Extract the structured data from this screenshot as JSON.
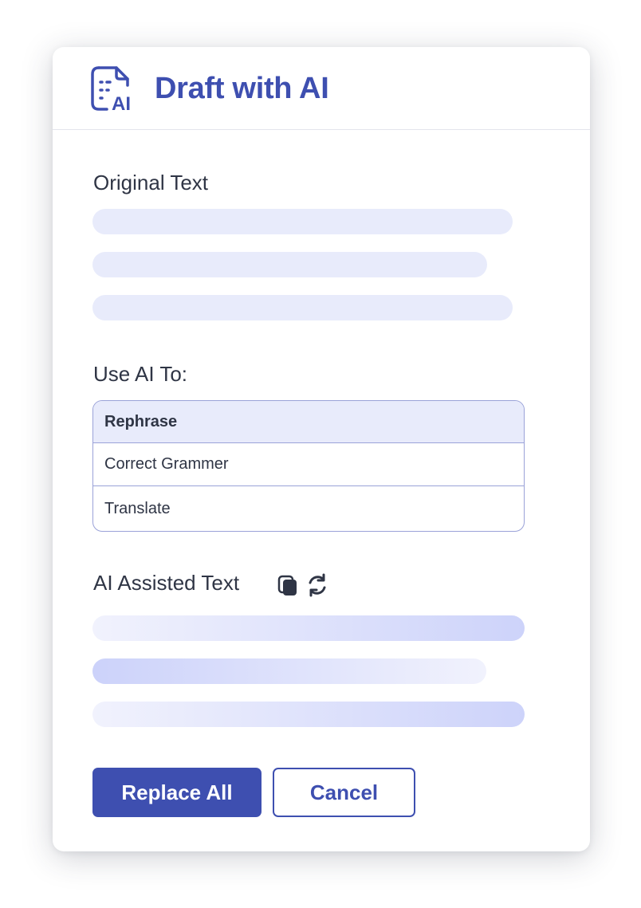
{
  "header": {
    "title": "Draft with AI",
    "icon": "document-ai-icon",
    "icon_label": "AI"
  },
  "original": {
    "label": "Original Text",
    "placeholder_lines": 3
  },
  "use_ai": {
    "label": "Use AI To:",
    "options": [
      {
        "label": "Rephrase",
        "selected": true
      },
      {
        "label": "Correct Grammer",
        "selected": false
      },
      {
        "label": "Translate",
        "selected": false
      }
    ]
  },
  "assisted": {
    "label": "AI Assisted Text",
    "copy_icon": "copy-icon",
    "regenerate_icon": "refresh-icon",
    "placeholder_lines": 3
  },
  "actions": {
    "replace_label": "Replace All",
    "cancel_label": "Cancel"
  },
  "colors": {
    "accent": "#3e4fb0",
    "skeleton": "#e8ebfb",
    "skeleton_ai": "#cdd3fa",
    "text": "#2f3545"
  }
}
